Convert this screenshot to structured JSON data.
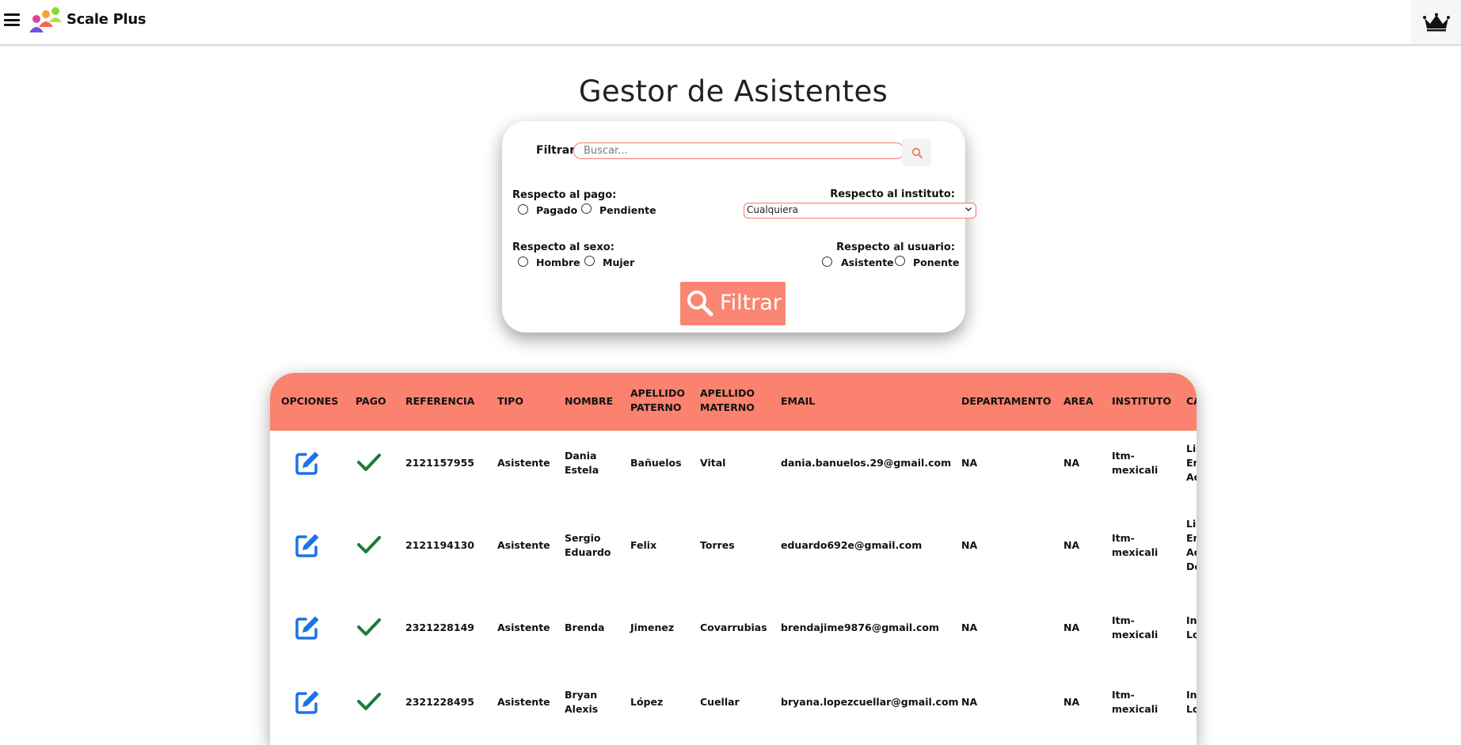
{
  "app": {
    "brand": "Scale Plus"
  },
  "icons": {
    "menu": "hamburger-icon",
    "logo": "people-logo",
    "admin": "crown-icon",
    "search": "search-icon",
    "edit": "edit-icon",
    "paid": "check-icon"
  },
  "colors": {
    "accent": "#fa826e",
    "input_border": "#f27b64",
    "edit_blue": "#1a73e8",
    "check_green": "#1e7a3c"
  },
  "page": {
    "title": "Gestor de Asistentes"
  },
  "filter": {
    "label": "Filtrar",
    "search_placeholder": "Buscar...",
    "payment": {
      "label": "Respecto al pago:",
      "options": [
        "Pagado",
        "Pendiente"
      ]
    },
    "institute": {
      "label": "Respecto al instituto:",
      "selected": "Cualquiera"
    },
    "sex": {
      "label": "Respecto al sexo:",
      "options": [
        "Hombre",
        "Mujer"
      ]
    },
    "user": {
      "label": "Respecto al usuario:",
      "options": [
        "Asistente",
        "Ponente"
      ]
    },
    "button_label": "Filtrar"
  },
  "table": {
    "columns": [
      "OPCIONES",
      "PAGO",
      "REFERENCIA",
      "TIPO",
      "NOMBRE",
      "APELLIDO PATERNO",
      "APELLIDO MATERNO",
      "EMAIL",
      "DEPARTAMENTO",
      "AREA",
      "INSTITUTO",
      "CA"
    ],
    "rows": [
      {
        "paid": true,
        "referencia": "2121157955",
        "tipo": "Asistente",
        "nombre": [
          "Dania",
          "Estela"
        ],
        "paterno": "Bañuelos",
        "materno": "Vital",
        "email": "dania.banuelos.29@gmail.com",
        "departamento": "NA",
        "area": "NA",
        "instituto": [
          "Itm-",
          "mexicali"
        ],
        "ca": [
          "Lic",
          "En",
          "Ac"
        ]
      },
      {
        "paid": true,
        "referencia": "2121194130",
        "tipo": "Asistente",
        "nombre": [
          "Sergio",
          "Eduardo"
        ],
        "paterno": "Felix",
        "materno": "Torres",
        "email": "eduardo692e@gmail.com",
        "departamento": "NA",
        "area": "NA",
        "instituto": [
          "Itm-",
          "mexicali"
        ],
        "ca": [
          "Lic",
          "En",
          "Ac",
          "De"
        ]
      },
      {
        "paid": true,
        "referencia": "2321228149",
        "tipo": "Asistente",
        "nombre": [
          "Brenda"
        ],
        "paterno": "Jimenez",
        "materno": "Covarrubias",
        "email": "brendajime9876@gmail.com",
        "departamento": "NA",
        "area": "NA",
        "instituto": [
          "Itm-",
          "mexicali"
        ],
        "ca": [
          "In",
          "Lo"
        ]
      },
      {
        "paid": true,
        "referencia": "2321228495",
        "tipo": "Asistente",
        "nombre": [
          "Bryan",
          "Alexis"
        ],
        "paterno": "López",
        "materno": "Cuellar",
        "email": "bryana.lopezcuellar@gmail.com",
        "departamento": "NA",
        "area": "NA",
        "instituto": [
          "Itm-",
          "mexicali"
        ],
        "ca": [
          "In",
          "Lo"
        ]
      }
    ]
  }
}
